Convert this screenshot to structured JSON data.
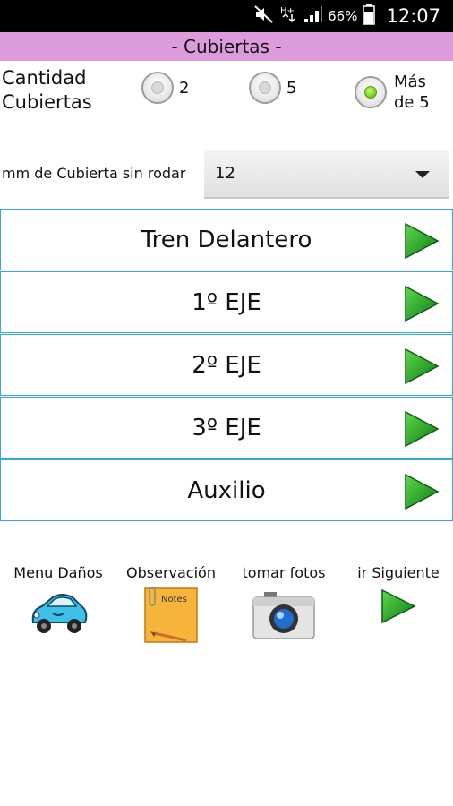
{
  "status_bar": {
    "battery": "66%",
    "time": "12:07",
    "icons": [
      "mute-icon",
      "network-hplus-icon",
      "signal-icon",
      "battery-icon"
    ]
  },
  "title": "- Cubiertas -",
  "quantity": {
    "label_line1": "Cantidad",
    "label_line2": "Cubiertas",
    "options": [
      {
        "label_line1": "2",
        "label_line2": "",
        "selected": false
      },
      {
        "label_line1": "5",
        "label_line2": "",
        "selected": false
      },
      {
        "label_line1": "Más",
        "label_line2": "de 5",
        "selected": true
      }
    ]
  },
  "tread": {
    "label": "mm de Cubierta sin rodar",
    "selected_value": "12"
  },
  "axles": [
    {
      "label": "Tren Delantero"
    },
    {
      "label": "1º EJE"
    },
    {
      "label": "2º EJE"
    },
    {
      "label": "3º EJE"
    },
    {
      "label": "Auxilio"
    }
  ],
  "bottom_menu": [
    {
      "label": "Menu Daños",
      "icon": "damaged-car-icon"
    },
    {
      "label": "Observación",
      "icon": "notes-icon"
    },
    {
      "label": "tomar fotos",
      "icon": "camera-icon"
    },
    {
      "label": "ir Siguiente",
      "icon": "next-arrow-icon"
    }
  ],
  "colors": {
    "title_bar": "#dc9cdc",
    "row_border": "#35a9de",
    "arrow_green": "#1a9a2a"
  }
}
